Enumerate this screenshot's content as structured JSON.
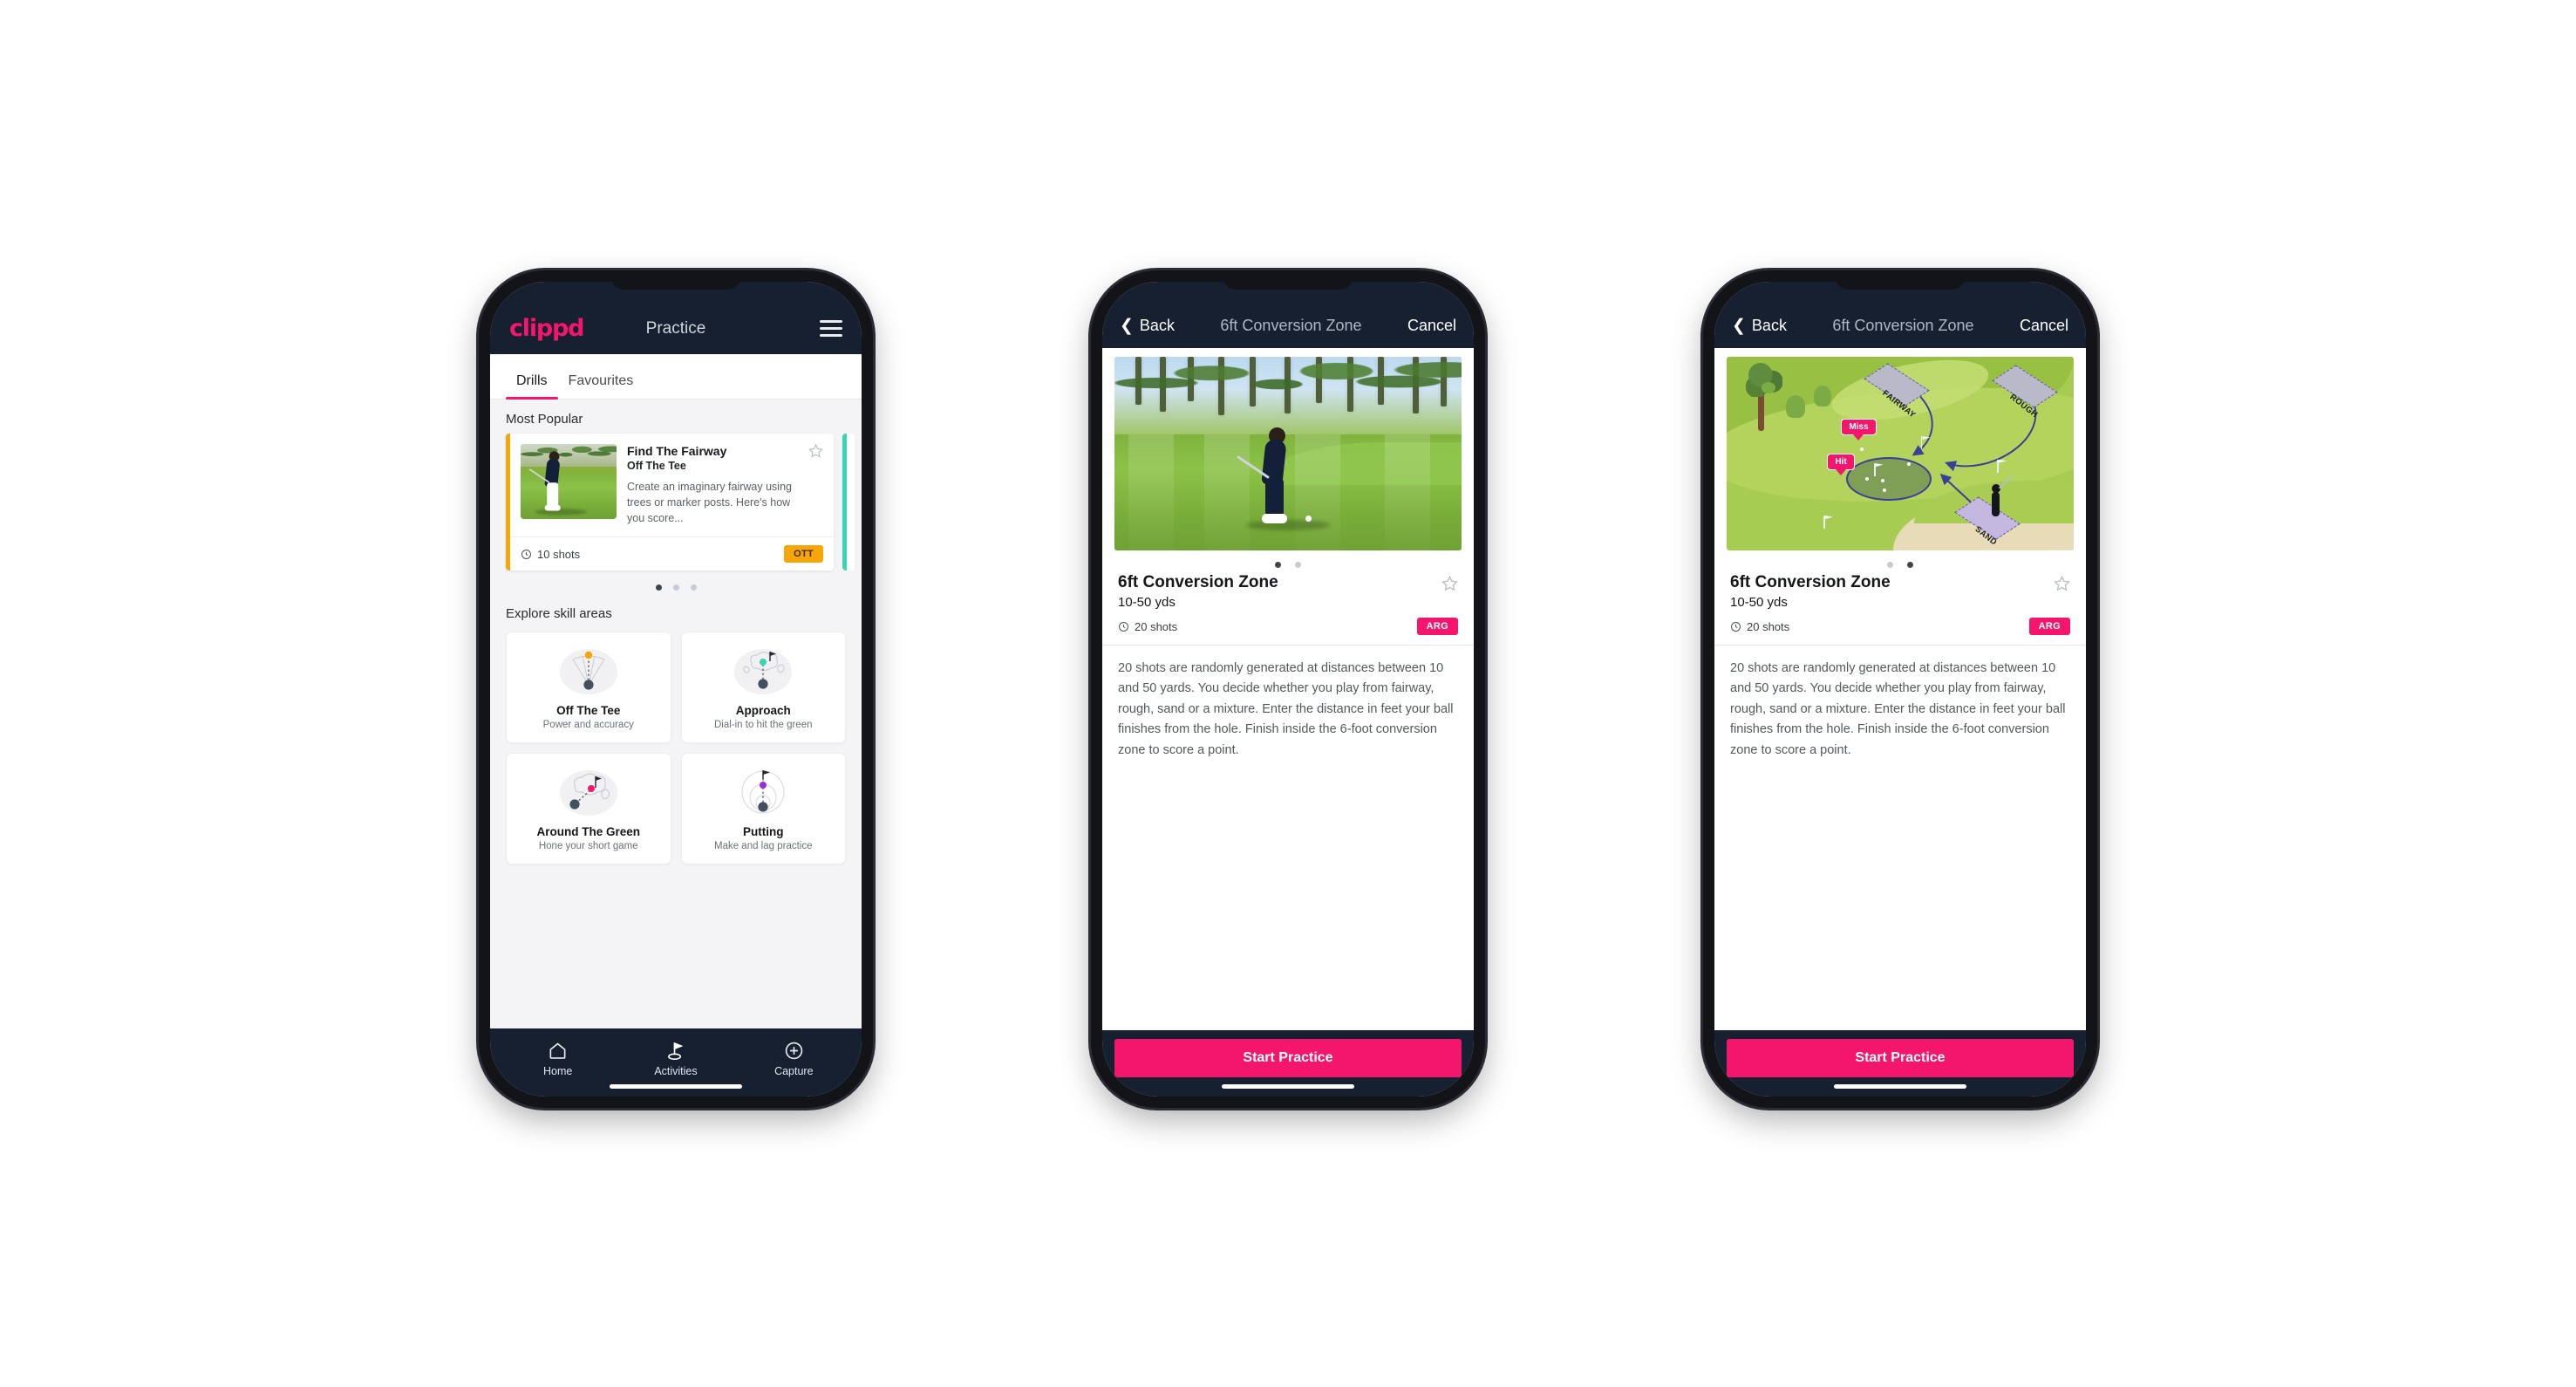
{
  "brand": {
    "name": "clippd",
    "accent": "#f4156c",
    "dark": "#172030",
    "amber": "#f6a609",
    "teal": "#36d6b0"
  },
  "phone1": {
    "appbar": {
      "logo": "clippd",
      "title": "Practice",
      "menu_icon": "hamburger-icon"
    },
    "tabs": [
      {
        "label": "Drills",
        "active": true
      },
      {
        "label": "Favourites",
        "active": false
      }
    ],
    "sections": {
      "most_popular": "Most Popular",
      "explore": "Explore skill areas"
    },
    "drill_card": {
      "title": "Find The Fairway",
      "subtitle": "Off The Tee",
      "description": "Create an imaginary fairway using trees or marker posts. Here's how you score...",
      "shots": "10 shots",
      "badge": "OTT",
      "badge_color": "#f6a609",
      "favourite_icon": "star-outline-icon",
      "shots_icon": "clock-icon"
    },
    "carousel_dots": {
      "count": 3,
      "active": 0
    },
    "skills": [
      {
        "name": "Off The Tee",
        "desc": "Power and accuracy",
        "icon": "tee-fan-icon",
        "accent": "#f6a609"
      },
      {
        "name": "Approach",
        "desc": "Dial-in to hit the green",
        "icon": "approach-green-icon",
        "accent": "#36d6b0"
      },
      {
        "name": "Around The Green",
        "desc": "Hone your short game",
        "icon": "chip-green-icon",
        "accent": "#f4156c"
      },
      {
        "name": "Putting",
        "desc": "Make and lag practice",
        "icon": "putting-rings-icon",
        "accent": "#9b2fd6"
      }
    ],
    "tabbar": [
      {
        "label": "Home",
        "icon": "home-icon",
        "active": false
      },
      {
        "label": "Activities",
        "icon": "golf-flag-icon",
        "active": true
      },
      {
        "label": "Capture",
        "icon": "plus-circle-icon",
        "active": false
      }
    ]
  },
  "phone2": {
    "navbar": {
      "back": "Back",
      "title": "6ft Conversion Zone",
      "cancel": "Cancel",
      "back_icon": "chevron-left-icon"
    },
    "hero": {
      "type": "photo",
      "alt": "golfer-chipping-photo"
    },
    "dots": {
      "count": 2,
      "active": 0
    },
    "detail": {
      "title": "6ft Conversion Zone",
      "subtitle": "10-50 yds",
      "shots": "20 shots",
      "badge": "ARG",
      "badge_color": "#f4156c",
      "favourite_icon": "star-outline-icon",
      "shots_icon": "clock-icon",
      "description": "20 shots are randomly generated at distances between 10 and 50 yards. You decide whether you play from fairway, rough, sand or a mixture. Enter the distance in feet your ball finishes from the hole. Finish inside the 6-foot conversion zone to score a point."
    },
    "cta": "Start Practice"
  },
  "phone3": {
    "navbar": {
      "back": "Back",
      "title": "6ft Conversion Zone",
      "cancel": "Cancel",
      "back_icon": "chevron-left-icon"
    },
    "hero": {
      "type": "diagram",
      "alt": "golf-course-diagram",
      "labels": {
        "fairway": "FAIRWAY",
        "rough": "ROUGH",
        "sand": "SAND"
      },
      "pins": {
        "miss": "Miss",
        "hit": "Hit"
      }
    },
    "dots": {
      "count": 2,
      "active": 1
    },
    "detail": {
      "title": "6ft Conversion Zone",
      "subtitle": "10-50 yds",
      "shots": "20 shots",
      "badge": "ARG",
      "badge_color": "#f4156c",
      "favourite_icon": "star-outline-icon",
      "shots_icon": "clock-icon",
      "description": "20 shots are randomly generated at distances between 10 and 50 yards. You decide whether you play from fairway, rough, sand or a mixture. Enter the distance in feet your ball finishes from the hole. Finish inside the 6-foot conversion zone to score a point."
    },
    "cta": "Start Practice"
  }
}
